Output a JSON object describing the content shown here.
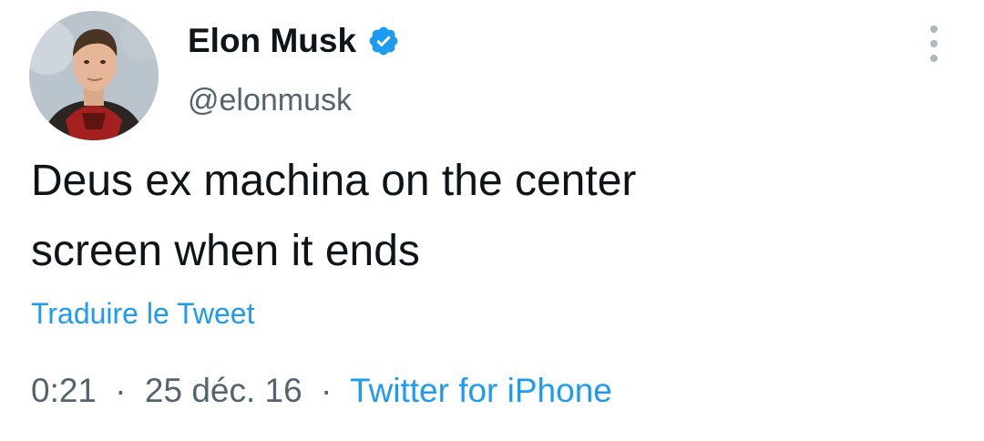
{
  "author": {
    "display_name": "Elon Musk",
    "handle": "@elonmusk",
    "verified": true,
    "avatar_icon": "profile-photo"
  },
  "tweet": {
    "text": "Deus ex machina on the center\nscreen when it ends",
    "translate_label": "Traduire le Tweet"
  },
  "meta": {
    "time": "0:21",
    "separator": "·",
    "date": "25 déc. 16",
    "source": "Twitter for iPhone"
  },
  "colors": {
    "link": "#1d9bf0",
    "secondary_text": "#536471",
    "primary_text": "#0f1419",
    "verified_badge": "#1d9bf0"
  },
  "icons": {
    "verified": "verified-badge-icon",
    "more": "more-options-icon"
  }
}
